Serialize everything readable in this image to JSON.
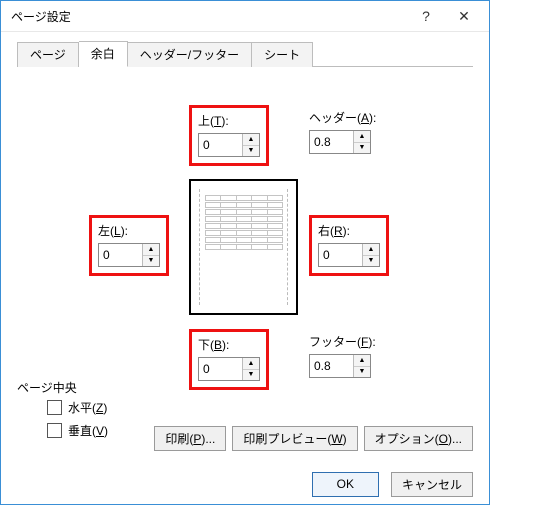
{
  "dialog": {
    "title": "ページ設定",
    "help_label": "?",
    "close_label": "✕"
  },
  "tabs": {
    "items": [
      {
        "label": "ページ"
      },
      {
        "label": "余白"
      },
      {
        "label": "ヘッダー/フッター"
      },
      {
        "label": "シート"
      }
    ],
    "active_index": 1
  },
  "margins": {
    "top": {
      "label_prefix": "上(",
      "accel": "T",
      "label_suffix": "):",
      "value": "0"
    },
    "header": {
      "label_prefix": "ヘッダー(",
      "accel": "A",
      "label_suffix": "):",
      "value": "0.8"
    },
    "left": {
      "label_prefix": "左(",
      "accel": "L",
      "label_suffix": "):",
      "value": "0"
    },
    "right": {
      "label_prefix": "右(",
      "accel": "R",
      "label_suffix": "):",
      "value": "0"
    },
    "bottom": {
      "label_prefix": "下(",
      "accel": "B",
      "label_suffix": "):",
      "value": "0"
    },
    "footer": {
      "label_prefix": "フッター(",
      "accel": "F",
      "label_suffix": "):",
      "value": "0.8"
    }
  },
  "center_section": {
    "title": "ページ中央",
    "horizontal": {
      "prefix": "水平(",
      "accel": "Z",
      "suffix": ")",
      "checked": false
    },
    "vertical": {
      "prefix": "垂直(",
      "accel": "V",
      "suffix": ")",
      "checked": false
    }
  },
  "buttons": {
    "print": {
      "prefix": "印刷(",
      "accel": "P",
      "suffix": ")..."
    },
    "preview": {
      "prefix": "印刷プレビュー(",
      "accel": "W",
      "suffix": ")"
    },
    "options": {
      "prefix": "オプション(",
      "accel": "O",
      "suffix": ")..."
    },
    "ok": "OK",
    "cancel": "キャンセル"
  },
  "highlight_color": "#e11"
}
